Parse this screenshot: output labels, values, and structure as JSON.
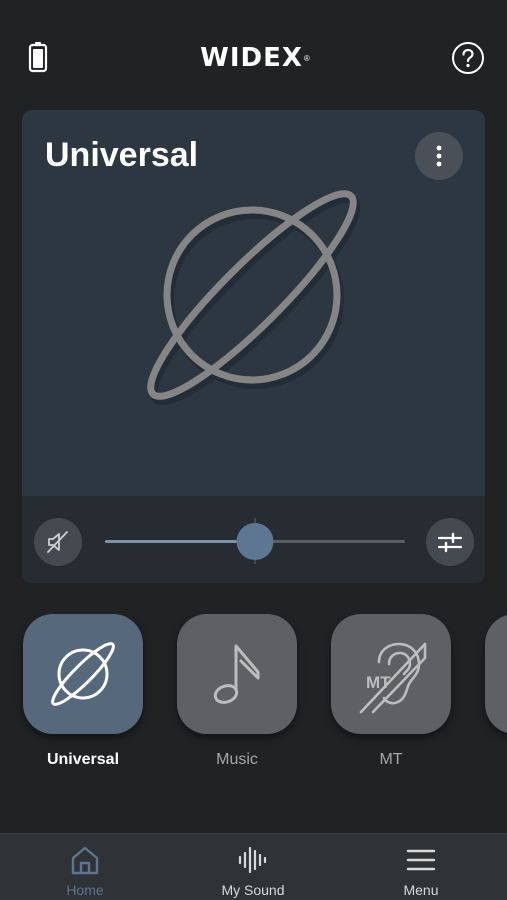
{
  "header": {
    "logo_text": "WIDEX",
    "logo_mark": "®",
    "battery_icon": "battery-icon",
    "help_icon": "question-mark-icon"
  },
  "program_card": {
    "title": "Universal",
    "icon": "planet-icon",
    "more_icon": "vertical-dots-icon",
    "mute_icon": "speaker-muted-icon",
    "adjust_icon": "sliders-icon",
    "volume_fraction": 0.5
  },
  "programs": [
    {
      "label": "Universal",
      "icon": "planet-icon",
      "active": true
    },
    {
      "label": "Music",
      "icon": "music-note-icon",
      "active": false
    },
    {
      "label": "MT",
      "icon": "ear-mt-icon",
      "active": false
    },
    {
      "label": "",
      "icon": "partial-tile",
      "active": false
    }
  ],
  "nav": [
    {
      "label": "Home",
      "icon": "home-icon",
      "active": true
    },
    {
      "label": "My Sound",
      "icon": "sound-wave-icon",
      "active": false
    },
    {
      "label": "Menu",
      "icon": "hamburger-menu-icon",
      "active": false
    }
  ],
  "colors": {
    "background": "#202224",
    "card": "#2c3742",
    "active_tile": "#56687b",
    "inactive_tile": "#5e6063",
    "accent": "#5d7792",
    "nav_active": "#5c7590"
  }
}
